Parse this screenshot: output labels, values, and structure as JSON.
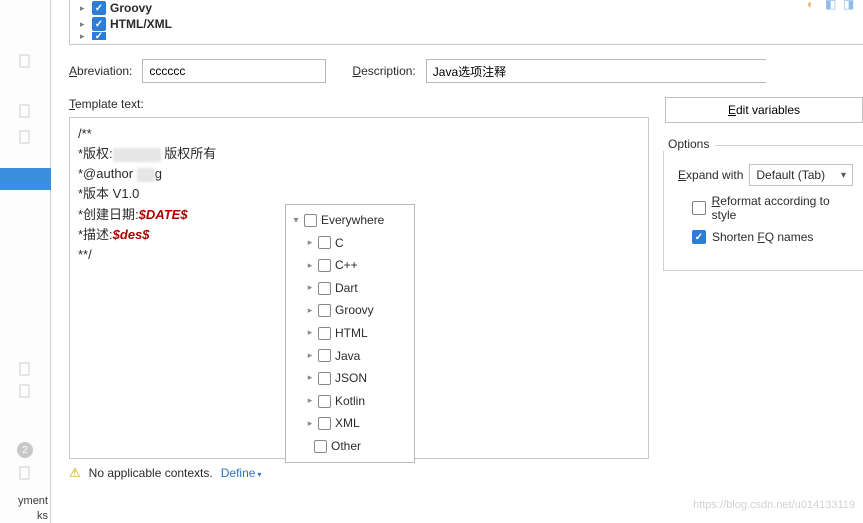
{
  "sidebar": {
    "label1": "yment",
    "label2": "ks",
    "badge": "2"
  },
  "topTree": {
    "items": [
      {
        "label": "Groovy",
        "checked": true
      },
      {
        "label": "HTML/XML",
        "checked": true
      }
    ]
  },
  "form": {
    "abbr_label": "breviation:",
    "abbr_mn": "A",
    "abbr_value": "cccccc",
    "desc_label": "escription:",
    "desc_mn": "D",
    "desc_value": "Java选项注释"
  },
  "template": {
    "label_pre": "T",
    "label": "emplate text:",
    "lines": {
      "l0": "/**",
      "l1a": "*版权:",
      "l1b": " 版权所有",
      "l2a": "*@author ",
      "l2b": "g",
      "l3": "*版本 V1.0",
      "l4a": "*创建日期:",
      "l4v": "$DATE$",
      "l5a": "*描述:",
      "l5v": "$des$",
      "l6": "**/"
    }
  },
  "contexts": {
    "items": [
      "Everywhere",
      "C",
      "C++",
      "Dart",
      "Groovy",
      "HTML",
      "Java",
      "JSON",
      "Kotlin",
      "XML",
      "Other"
    ]
  },
  "footer": {
    "warn": "No applicable contexts.",
    "define": "Define"
  },
  "right": {
    "edit_pre": "E",
    "edit": "dit variables",
    "options_title": "Options",
    "expand_pre": "E",
    "expand": "xpand with",
    "expand_value": "Default (Tab)",
    "reformat_pre": "R",
    "reformat": "eformat according to style",
    "shorten_a": "Shorten ",
    "shorten_mn": "F",
    "shorten_b": "Q names"
  },
  "watermark": "https://blog.csdn.net/u014133119"
}
